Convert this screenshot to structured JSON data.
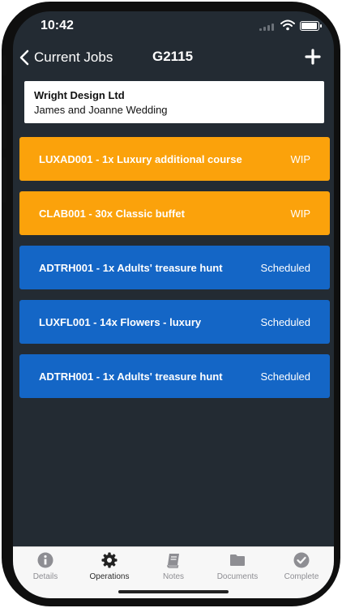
{
  "status_bar": {
    "time": "10:42"
  },
  "nav": {
    "back_label": "Current Jobs",
    "title": "G2115"
  },
  "customer": {
    "company": "Wright Design Ltd",
    "event": "James and Joanne Wedding"
  },
  "jobs": [
    {
      "label": "LUXAD001 - 1x Luxury additional course",
      "status": "WIP"
    },
    {
      "label": "CLAB001 - 30x Classic buffet",
      "status": "WIP"
    },
    {
      "label": "ADTRH001 - 1x Adults' treasure hunt",
      "status": "Scheduled"
    },
    {
      "label": "LUXFL001 - 14x Flowers - luxury",
      "status": "Scheduled"
    },
    {
      "label": "ADTRH001 - 1x Adults' treasure hunt",
      "status": "Scheduled"
    }
  ],
  "status_colors": {
    "WIP": "#fba20b",
    "Scheduled": "#1466c6"
  },
  "tabs": [
    {
      "label": "Details",
      "icon": "info-icon"
    },
    {
      "label": "Operations",
      "icon": "gear-icon",
      "active": true
    },
    {
      "label": "Notes",
      "icon": "book-icon"
    },
    {
      "label": "Documents",
      "icon": "folder-icon"
    },
    {
      "label": "Complete",
      "icon": "check-circle-icon"
    }
  ]
}
